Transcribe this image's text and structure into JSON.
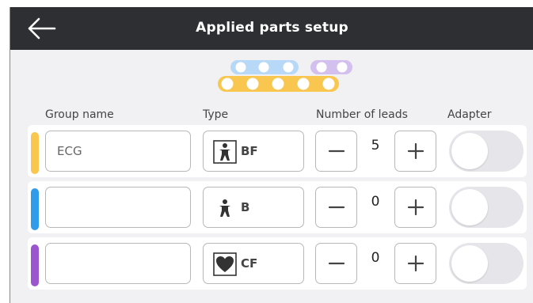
{
  "header": {
    "title": "Applied parts setup"
  },
  "columns": {
    "group_name": "Group name",
    "type": "Type",
    "leads": "Number of leads",
    "adapter": "Adapter"
  },
  "colors": {
    "yellow": "#f9c74f",
    "blue": "#2f9ceb",
    "purple": "#9b55cf",
    "light_blue": "#b7d8f7",
    "light_purple": "#d3c0ee"
  },
  "rows": [
    {
      "group_name": "ECG",
      "type": "BF",
      "type_icon": "person-box-icon",
      "leads": "5",
      "adapter_on": false,
      "color": "#f9c74f"
    },
    {
      "group_name": "",
      "type": "B",
      "type_icon": "person-icon",
      "leads": "0",
      "adapter_on": false,
      "color": "#2f9ceb"
    },
    {
      "group_name": "",
      "type": "CF",
      "type_icon": "heart-box-icon",
      "leads": "0",
      "adapter_on": false,
      "color": "#9b55cf"
    }
  ]
}
